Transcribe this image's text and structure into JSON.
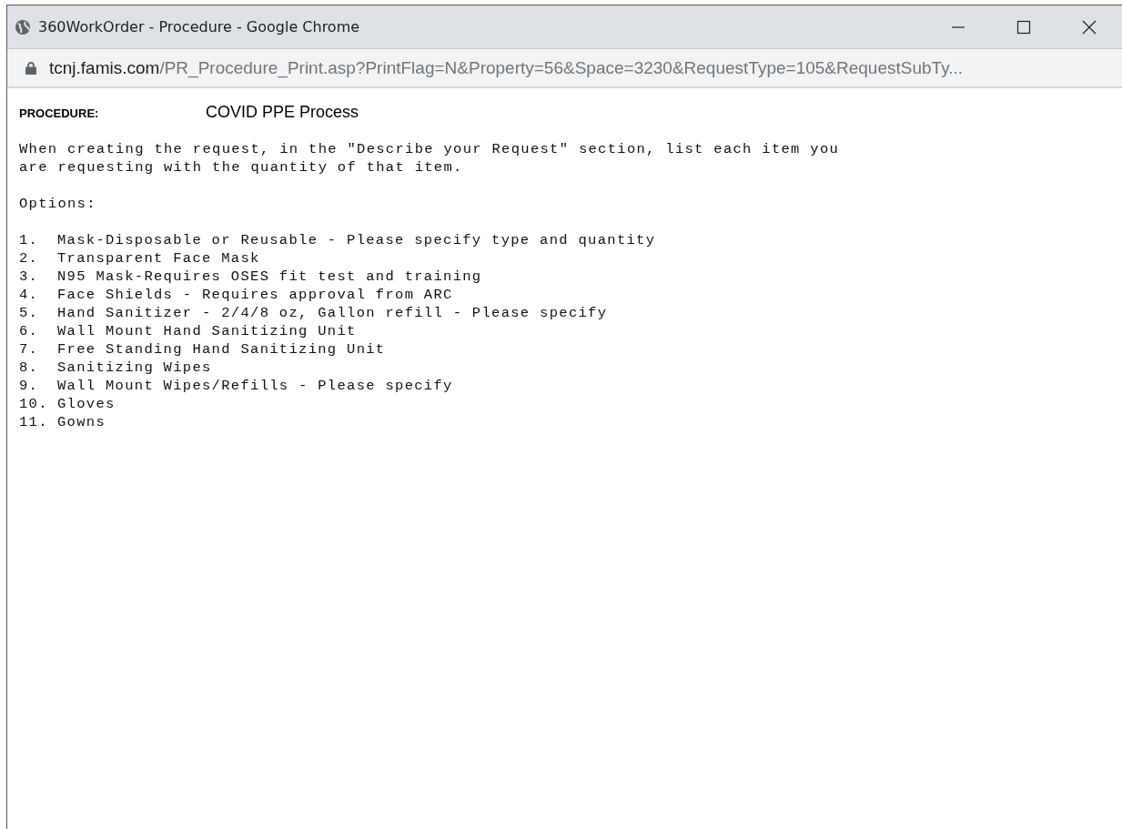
{
  "window": {
    "title": "360WorkOrder - Procedure - Google Chrome"
  },
  "address_bar": {
    "domain": "tcnj.famis.com",
    "path": "/PR_Procedure_Print.asp?PrintFlag=N&Property=56&Space=3230&RequestType=105&RequestSubTy..."
  },
  "procedure": {
    "label": "PROCEDURE:",
    "name": "COVID PPE Process"
  },
  "intro": "When creating the request, in the \"Describe your Request\" section, list each item you are requesting with the quantity of that item.",
  "options_heading": "Options:",
  "options": [
    {
      "number": "1.",
      "text": "Mask-Disposable or Reusable - Please specify type and quantity"
    },
    {
      "number": "2.",
      "text": "Transparent Face Mask"
    },
    {
      "number": "3.",
      "text": "N95 Mask-Requires OSES fit test and training"
    },
    {
      "number": "4.",
      "text": "Face Shields - Requires approval from ARC"
    },
    {
      "number": "5.",
      "text": "Hand Sanitizer - 2/4/8 oz, Gallon refill - Please specify"
    },
    {
      "number": "6.",
      "text": "Wall Mount Hand Sanitizing Unit"
    },
    {
      "number": "7.",
      "text": "Free Standing Hand Sanitizing Unit"
    },
    {
      "number": "8.",
      "text": "Sanitizing Wipes"
    },
    {
      "number": "9.",
      "text": "Wall Mount Wipes/Refills - Please specify"
    },
    {
      "number": "10.",
      "text": "Gloves"
    },
    {
      "number": "11.",
      "text": "Gowns"
    }
  ]
}
